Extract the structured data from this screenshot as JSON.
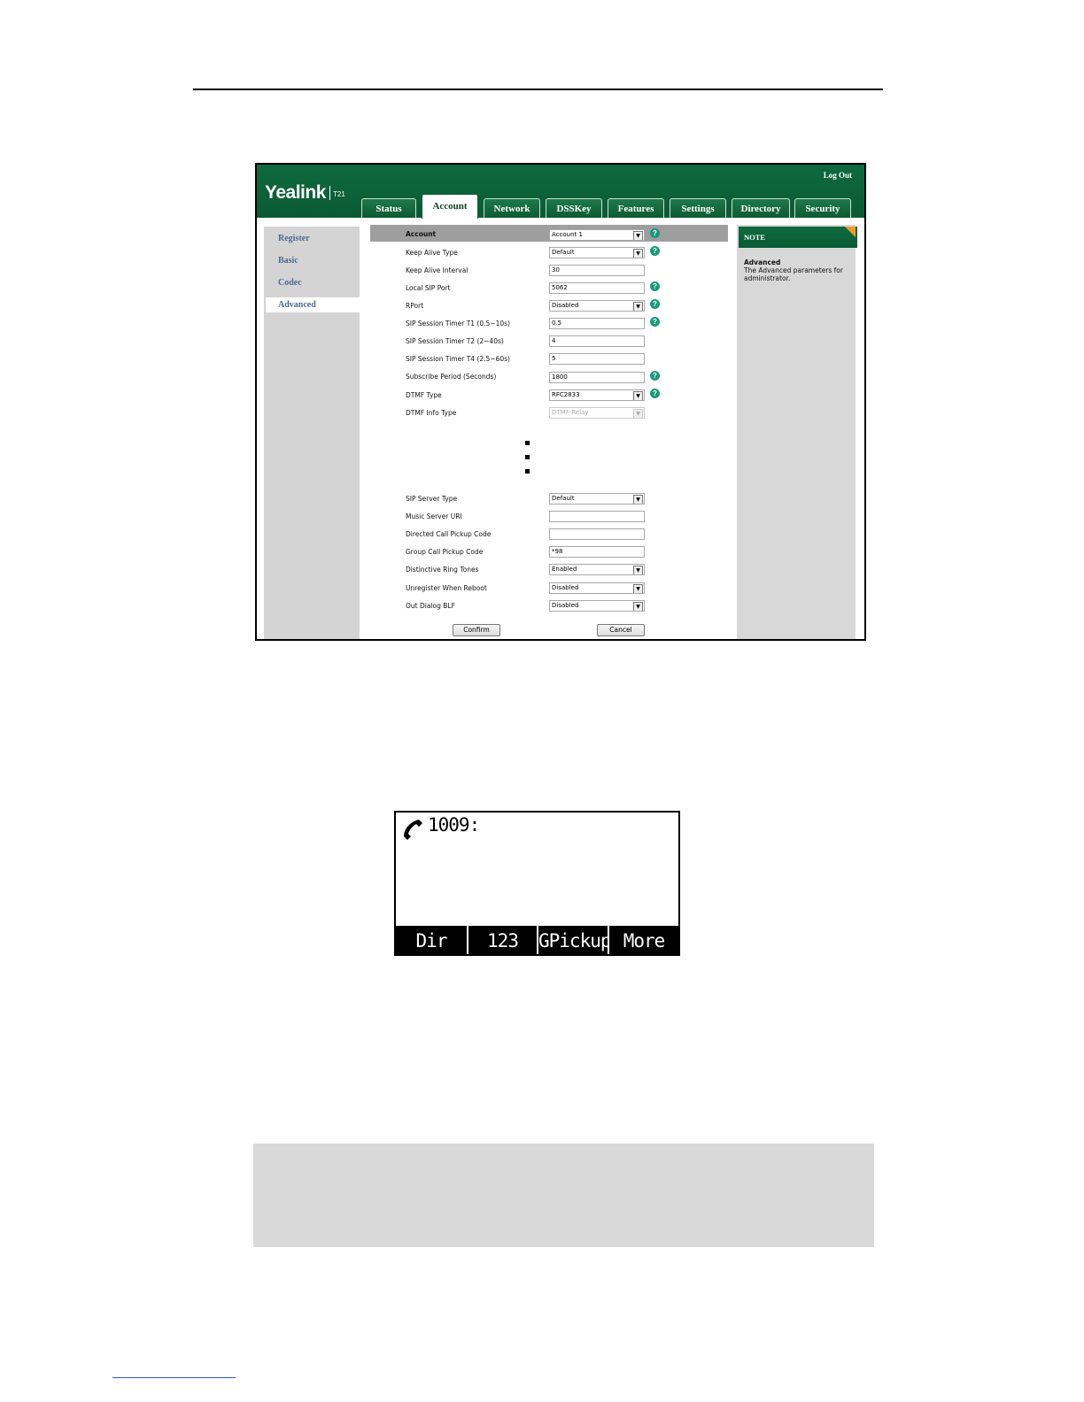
{
  "web_ui": {
    "brand": "Yealink",
    "model": "T21",
    "logout": "Log Out",
    "tabs": [
      "Status",
      "Account",
      "Network",
      "DSSKey",
      "Features",
      "Settings",
      "Directory",
      "Security"
    ],
    "active_tab": "Account",
    "side_nav": [
      "Register",
      "Basic",
      "Codec",
      "Advanced"
    ],
    "active_nav": "Advanced",
    "fields": [
      {
        "label": "Account",
        "value": "Account 1",
        "type": "select"
      },
      {
        "label": "Keep Alive Type",
        "value": "Default",
        "type": "select"
      },
      {
        "label": "Keep Alive Interval",
        "value": "30",
        "type": "text"
      },
      {
        "label": "Local SIP Port",
        "value": "5062",
        "type": "text"
      },
      {
        "label": "RPort",
        "value": "Disabled",
        "type": "select"
      },
      {
        "label": "SIP Session Timer T1 (0.5~10s)",
        "value": "0.5",
        "type": "text"
      },
      {
        "label": "SIP Session Timer T2 (2~40s)",
        "value": "4",
        "type": "text"
      },
      {
        "label": "SIP Session Timer T4 (2.5~60s)",
        "value": "5",
        "type": "text"
      },
      {
        "label": "Subscribe Period (Seconds)",
        "value": "1800",
        "type": "text"
      },
      {
        "label": "DTMF Type",
        "value": "RFC2833",
        "type": "select"
      },
      {
        "label": "DTMF Info Type",
        "value": "DTMF-Relay",
        "type": "select"
      },
      {
        "label": "SIP Server Type",
        "value": "Default",
        "type": "select"
      },
      {
        "label": "Music Server URI",
        "value": "",
        "type": "text"
      },
      {
        "label": "Directed Call Pickup Code",
        "value": "",
        "type": "text"
      },
      {
        "label": "Group Call Pickup Code",
        "value": "*98",
        "type": "text"
      },
      {
        "label": "Distinctive Ring Tones",
        "value": "Enabled",
        "type": "select"
      },
      {
        "label": "Unregister When Reboot",
        "value": "Disabled",
        "type": "select"
      },
      {
        "label": "Out Dialog BLF",
        "value": "Disabled",
        "type": "select"
      }
    ],
    "confirm_label": "Confirm",
    "cancel_label": "Cancel",
    "note": {
      "title": "NOTE",
      "subtitle": "Advanced",
      "text": "The Advanced parameters for administrator."
    }
  },
  "phone_screen": {
    "line_text": "1009:",
    "softkeys": [
      "Dir",
      "123",
      "GPickup",
      "More"
    ]
  }
}
